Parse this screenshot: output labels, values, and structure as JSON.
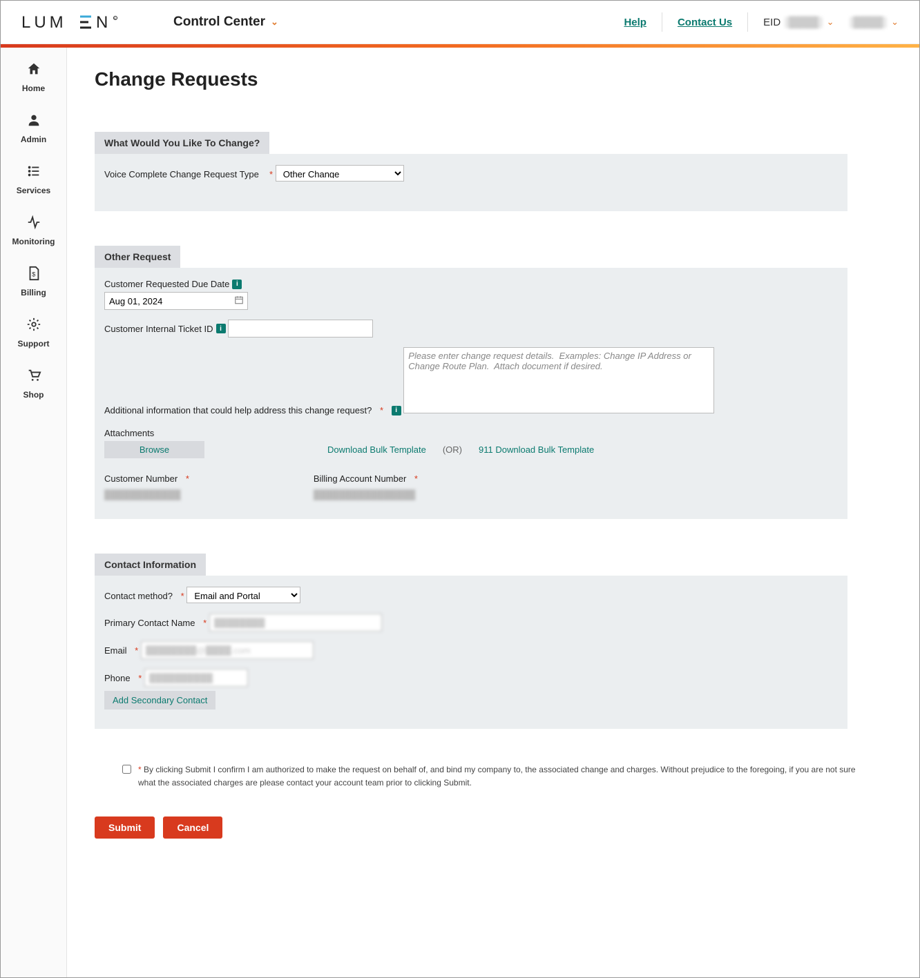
{
  "header": {
    "logo_text": "LUMEN",
    "control_center": "Control Center",
    "help": "Help",
    "contact": "Contact Us",
    "eid_label": "EID",
    "eid_value": "████",
    "user_value": "████"
  },
  "sidebar": {
    "items": [
      {
        "label": "Home"
      },
      {
        "label": "Admin"
      },
      {
        "label": "Services"
      },
      {
        "label": "Monitoring"
      },
      {
        "label": "Billing"
      },
      {
        "label": "Support"
      },
      {
        "label": "Shop"
      }
    ]
  },
  "page": {
    "title": "Change Requests"
  },
  "section_change": {
    "tab": "What Would You Like To Change?",
    "type_label": "Voice Complete Change Request Type",
    "type_value": "Other Change"
  },
  "section_other": {
    "tab": "Other Request",
    "due_label": "Customer Requested Due Date",
    "due_value": "Aug 01, 2024",
    "ticket_label": "Customer Internal Ticket ID",
    "ticket_value": "",
    "addl_label": "Additional information that could help address this change request?",
    "addl_placeholder": "Please enter change request details.  Examples: Change IP Address or Change Route Plan.  Attach document if desired.",
    "attachments_label": "Attachments",
    "browse": "Browse",
    "dl_template": "Download Bulk Template",
    "or": "(OR)",
    "dl_911": "911 Download Bulk Template",
    "cust_num_label": "Customer Number",
    "cust_num_value": "████████████",
    "ban_label": "Billing Account Number",
    "ban_value": "████████████████"
  },
  "section_contact": {
    "tab": "Contact Information",
    "method_label": "Contact method?",
    "method_value": "Email and Portal",
    "name_label": "Primary Contact Name",
    "name_value": "████████",
    "email_label": "Email",
    "email_value": "████████@████.com",
    "phone_label": "Phone",
    "phone_value": "██████████",
    "add_secondary": "Add Secondary Contact"
  },
  "disclaimer": {
    "text": "By clicking Submit I confirm I am authorized to make the request on behalf of, and bind my company to, the associated change and charges. Without prejudice to the foregoing, if you are not sure what the associated charges are please contact your account team prior to clicking Submit."
  },
  "actions": {
    "submit": "Submit",
    "cancel": "Cancel"
  }
}
